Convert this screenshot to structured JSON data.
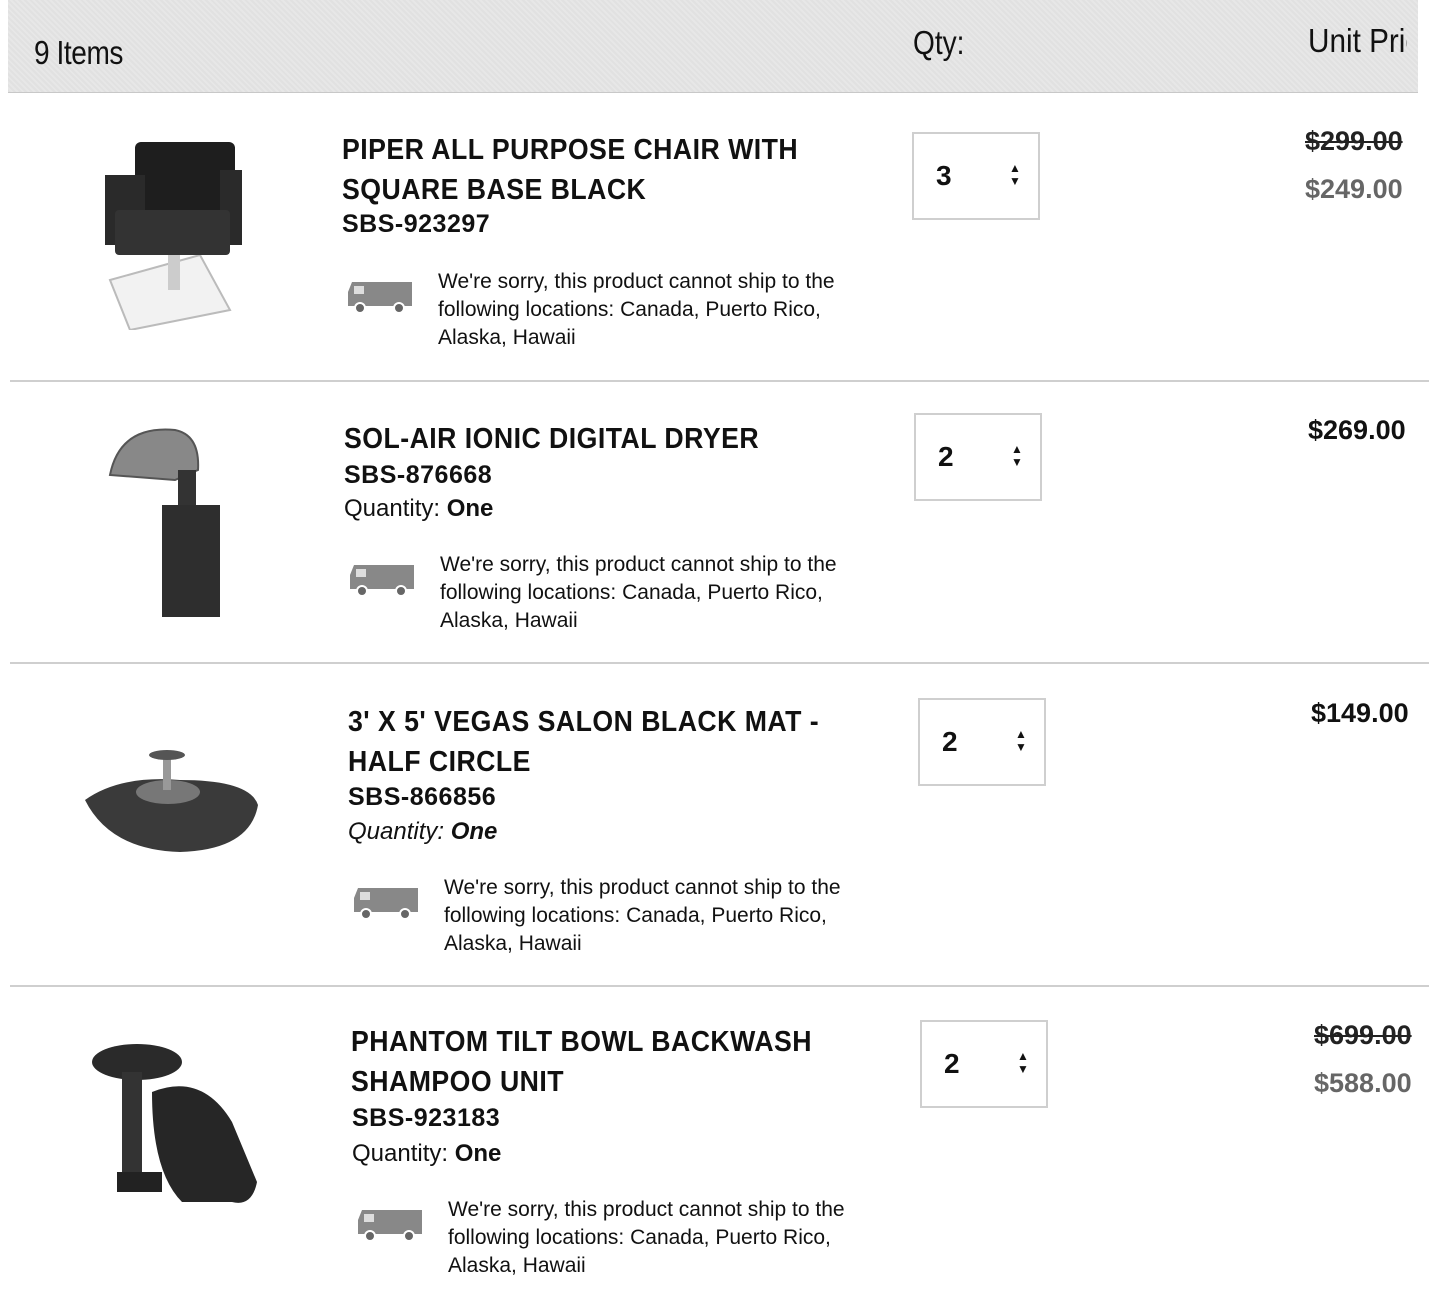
{
  "header": {
    "count": "9 Items",
    "qty": "Qty:",
    "unit_price": "Unit Pric"
  },
  "items": [
    {
      "name": "PIPER ALL PURPOSE CHAIR WITH SQUARE BASE BLACK",
      "sku": "SBS-923297",
      "quantity_label": "",
      "quantity_value": "",
      "ship_message": "We're sorry, this product cannot ship to the following locations: Canada, Puerto Rico, Alaska, Hawaii",
      "qty": "3",
      "price_old": "$299.00",
      "price": "$249.00",
      "thumb_icon": "salon-chair-icon"
    },
    {
      "name": "SOL-AIR IONIC DIGITAL DRYER",
      "sku": "SBS-876668",
      "quantity_label": "Quantity: ",
      "quantity_value": "One",
      "ship_message": "We're sorry, this product cannot ship to the following locations: Canada, Puerto Rico, Alaska, Hawaii",
      "qty": "2",
      "price_old": "",
      "price": "$269.00",
      "thumb_icon": "hood-dryer-icon"
    },
    {
      "name": "3' X 5' VEGAS SALON BLACK MAT - HALF CIRCLE",
      "sku": "SBS-866856",
      "quantity_label": "Quantity: ",
      "quantity_value": "One",
      "ship_message": "We're sorry, this product cannot ship to the following locations: Canada, Puerto Rico, Alaska, Hawaii",
      "qty": "2",
      "price_old": "",
      "price": "$149.00",
      "thumb_icon": "floor-mat-icon"
    },
    {
      "name": "PHANTOM TILT BOWL BACKWASH SHAMPOO UNIT",
      "sku": "SBS-923183",
      "quantity_label": "Quantity: ",
      "quantity_value": "One",
      "ship_message": "We're sorry, this product cannot ship to the following locations: Canada, Puerto Rico, Alaska, Hawaii",
      "qty": "2",
      "price_old": "$699.00",
      "price": "$588.00",
      "thumb_icon": "backwash-unit-icon"
    }
  ]
}
